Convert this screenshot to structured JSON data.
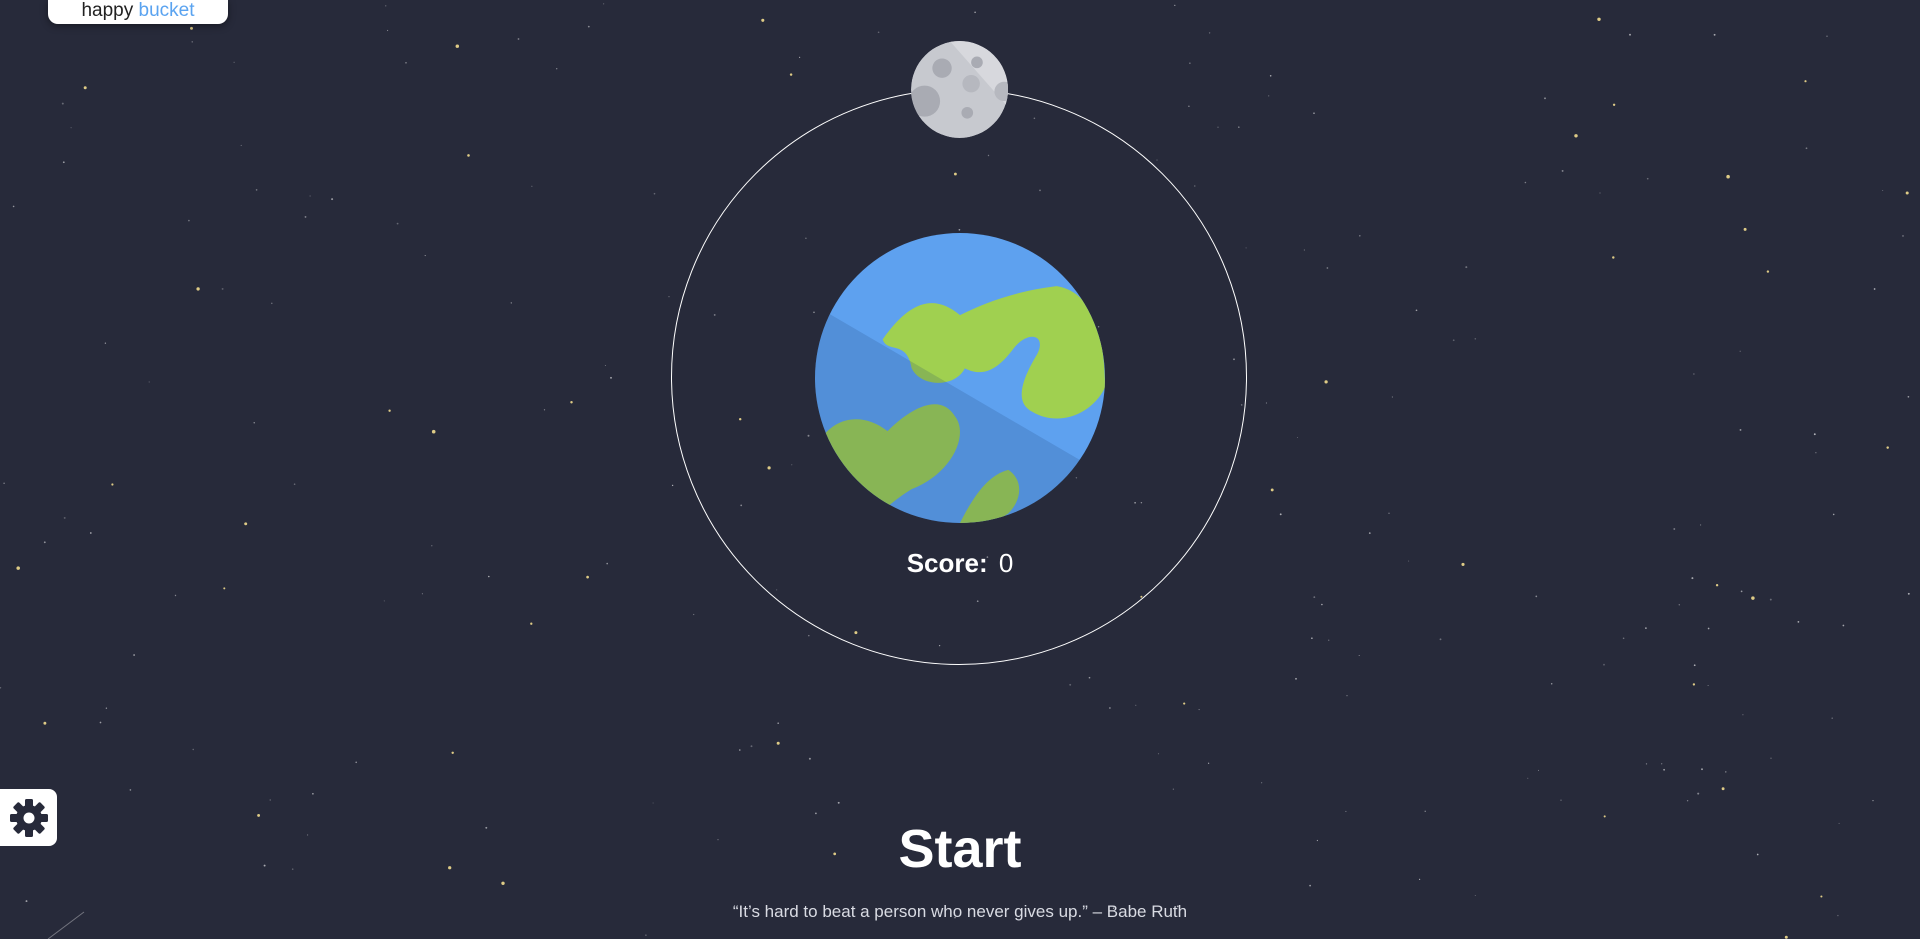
{
  "logo": {
    "word1": "happy",
    "word2": "bucket",
    "accent_color": "#5aa3f0"
  },
  "game": {
    "score_label": "Score:",
    "score_value": "0",
    "start_label": "Start",
    "quote": "“It’s hard to beat a person who never gives up.” – Babe Ruth"
  },
  "colors": {
    "background": "#272a3a",
    "ocean": "#5ea1ef",
    "ocean_shadow": "#5289d1",
    "land": "#a0d050",
    "land_shadow": "#88b044",
    "moon": "#c7c9cf",
    "moon_crater": "#a9abb3",
    "orbit": "#ffffff",
    "star": "#f3dd8f"
  },
  "icons": {
    "settings": "gear-icon",
    "moon": "moon-icon",
    "earth": "earth-icon"
  }
}
